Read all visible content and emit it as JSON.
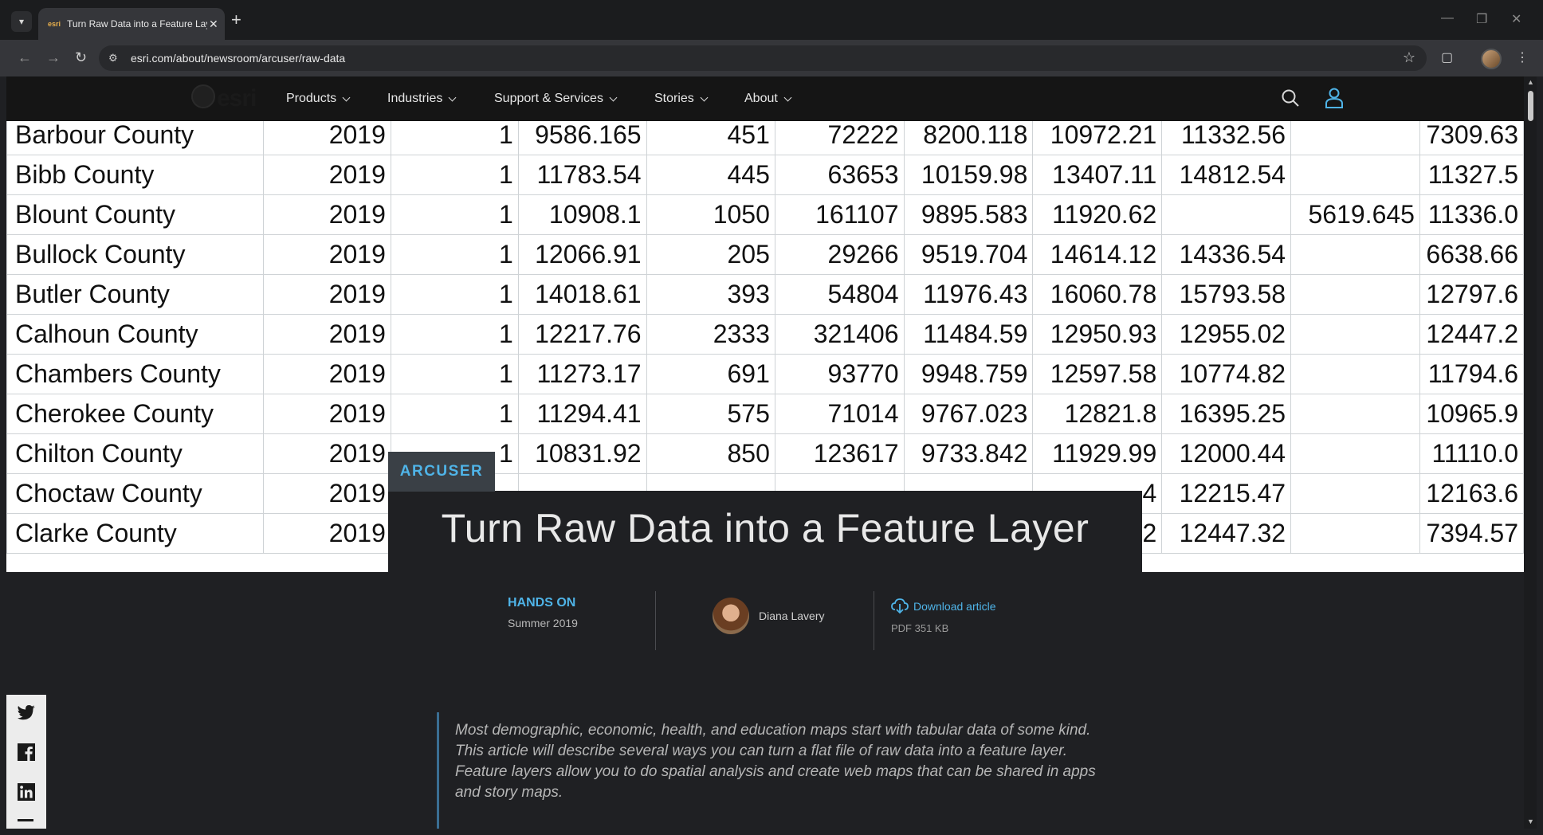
{
  "browser": {
    "tab_title": "Turn Raw Data into a Feature Layer",
    "favicon_text": "esri",
    "url": "esri.com/about/newsroom/arcuser/raw-data"
  },
  "site": {
    "logo_text": "esri",
    "nav": [
      {
        "label": "Products"
      },
      {
        "label": "Industries"
      },
      {
        "label": "Support & Services"
      },
      {
        "label": "Stories"
      },
      {
        "label": "About"
      }
    ]
  },
  "table_rows": [
    [
      "Barbour County",
      "2019",
      "1",
      "9586.165",
      "451",
      "72222",
      "8200.118",
      "10972.21",
      "11332.56",
      "",
      "7309.63"
    ],
    [
      "Bibb County",
      "2019",
      "1",
      "11783.54",
      "445",
      "63653",
      "10159.98",
      "13407.11",
      "14812.54",
      "",
      "11327.5"
    ],
    [
      "Blount County",
      "2019",
      "1",
      "10908.1",
      "1050",
      "161107",
      "9895.583",
      "11920.62",
      "",
      "5619.645",
      "11336.0"
    ],
    [
      "Bullock County",
      "2019",
      "1",
      "12066.91",
      "205",
      "29266",
      "9519.704",
      "14614.12",
      "14336.54",
      "",
      "6638.66"
    ],
    [
      "Butler County",
      "2019",
      "1",
      "14018.61",
      "393",
      "54804",
      "11976.43",
      "16060.78",
      "15793.58",
      "",
      "12797.6"
    ],
    [
      "Calhoun County",
      "2019",
      "1",
      "12217.76",
      "2333",
      "321406",
      "11484.59",
      "12950.93",
      "12955.02",
      "",
      "12447.2"
    ],
    [
      "Chambers County",
      "2019",
      "1",
      "11273.17",
      "691",
      "93770",
      "9948.759",
      "12597.58",
      "10774.82",
      "",
      "11794.6"
    ],
    [
      "Cherokee County",
      "2019",
      "1",
      "11294.41",
      "575",
      "71014",
      "9767.023",
      "12821.8",
      "16395.25",
      "",
      "10965.9"
    ],
    [
      "Chilton County",
      "2019",
      "1",
      "10831.92",
      "850",
      "123617",
      "9733.842",
      "11929.99",
      "12000.44",
      "",
      "11110.0"
    ],
    [
      "Choctaw County",
      "2019",
      "",
      "",
      "",
      "",
      "",
      "4",
      "12215.47",
      "",
      "12163.6"
    ],
    [
      "Clarke County",
      "2019",
      "",
      "",
      "",
      "",
      "",
      "2",
      "12447.32",
      "",
      "7394.57"
    ]
  ],
  "article": {
    "badge": "ARCUSER",
    "title": "Turn Raw Data into a Feature Layer",
    "category": "HANDS ON",
    "issue": "Summer 2019",
    "author": "Diana Lavery",
    "download_label": "Download article",
    "download_size": "PDF 351 KB",
    "intro": "Most demographic, economic, health, and education maps start with tabular data of some kind. This article will describe several ways you can turn a flat file of raw data into a feature layer. Feature layers allow you to do spatial analysis and create web maps that can be shared in apps and story maps."
  },
  "social": [
    "twitter-icon",
    "facebook-icon",
    "linkedin-icon"
  ]
}
